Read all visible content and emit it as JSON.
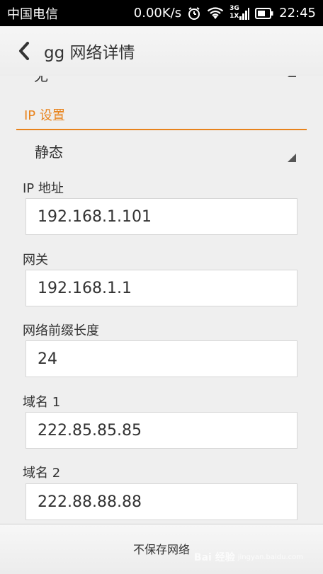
{
  "status_bar": {
    "carrier": "中国电信",
    "speed": "0.00K/s",
    "network_type_top": "3G",
    "network_type_bottom": "1X",
    "time": "22:45"
  },
  "header": {
    "title": "gg 网络详情"
  },
  "partial_spinner": {
    "value": "无"
  },
  "ip_settings": {
    "section_title": "IP 设置",
    "mode": "静态"
  },
  "fields": [
    {
      "label": "IP 地址",
      "value": "192.168.1.101"
    },
    {
      "label": "网关",
      "value": "192.168.1.1"
    },
    {
      "label": "网络前缀长度",
      "value": "24"
    },
    {
      "label": "域名 1",
      "value": "222.85.85.85"
    },
    {
      "label": "域名 2",
      "value": "222.88.88.88"
    }
  ],
  "bottom_bar": {
    "button_label": "不保存网络"
  },
  "watermark": {
    "text": "Bai 经验",
    "url": "jingyan.baidu.com"
  },
  "colors": {
    "accent": "#e8831c",
    "status_bar_bg": "#000000",
    "page_bg": "#efefef"
  }
}
